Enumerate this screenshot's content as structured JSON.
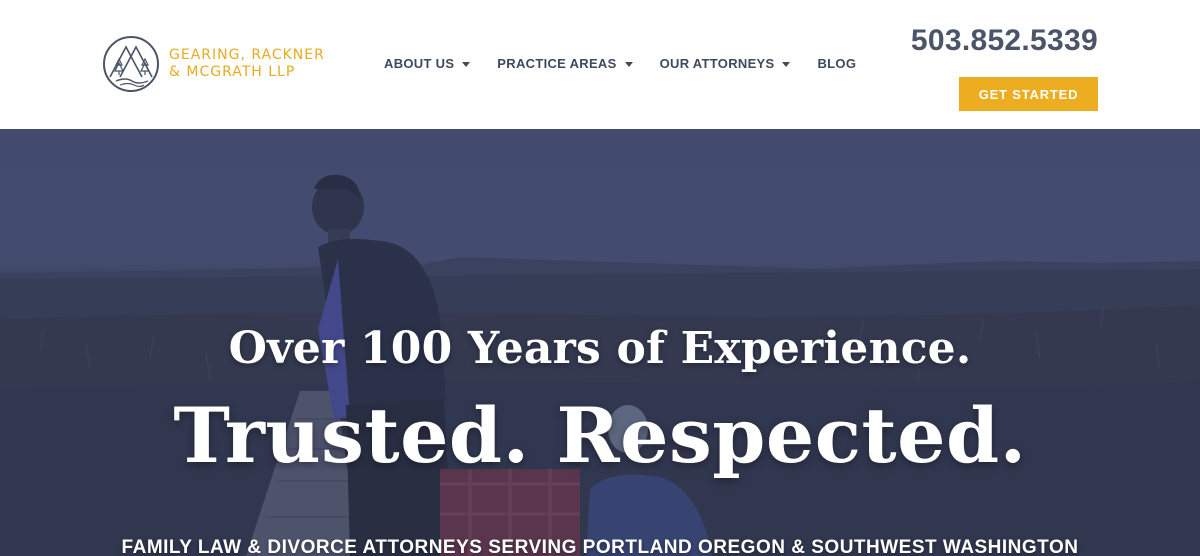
{
  "brand": {
    "line1": "GEARING, RACKNER",
    "line2": "& MCGRATH LLP",
    "accent_color": "#edad21",
    "logo_icon": "mountain-trees-river-icon"
  },
  "nav": {
    "items": [
      {
        "label": "ABOUT US",
        "has_dropdown": true
      },
      {
        "label": "PRACTICE AREAS",
        "has_dropdown": true
      },
      {
        "label": "OUR ATTORNEYS",
        "has_dropdown": true
      },
      {
        "label": "BLOG",
        "has_dropdown": false
      }
    ]
  },
  "contact": {
    "phone": "503.852.5339",
    "cta_label": "GET STARTED"
  },
  "hero": {
    "line1": "Over 100 Years of Experience.",
    "line2": "Trusted. Respected.",
    "line3": "FAMILY LAW & DIVORCE ATTORNEYS SERVING PORTLAND OREGON & SOUTHWEST WASHINGTON"
  }
}
